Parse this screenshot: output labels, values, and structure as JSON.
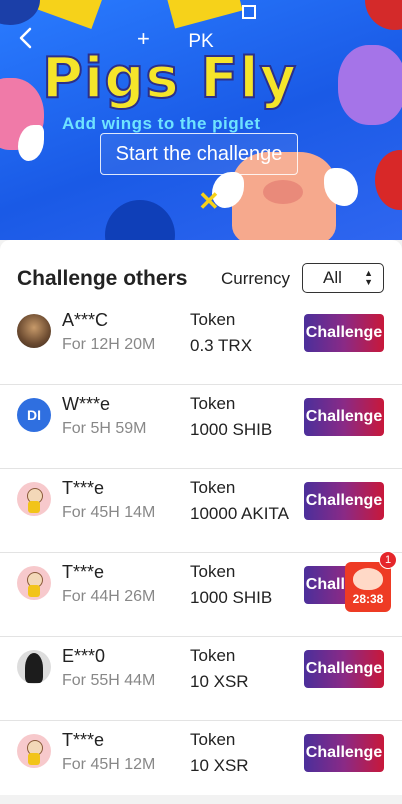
{
  "banner": {
    "page_label": "PK",
    "title": "Pigs Fly",
    "subtitle": "Add wings to the piglet",
    "start_button": "Start the challenge"
  },
  "section": {
    "title": "Challenge others",
    "currency_label": "Currency",
    "currency_value": "All"
  },
  "rows": [
    {
      "user": "A***C",
      "time": "For 12H 20M",
      "token_label": "Token",
      "amount": "0.3 TRX",
      "button": "Challenge",
      "avatar": "photo"
    },
    {
      "user": "W***e",
      "time": "For 5H 59M",
      "token_label": "Token",
      "amount": "1000 SHIB",
      "button": "Challenge",
      "avatar": "logo"
    },
    {
      "user": "T***e",
      "time": "For 45H 14M",
      "token_label": "Token",
      "amount": "10000 AKITA",
      "button": "Challenge",
      "avatar": "cartoon"
    },
    {
      "user": "T***e",
      "time": "For 44H 26M",
      "token_label": "Token",
      "amount": "1000 SHIB",
      "button": "Challenge",
      "avatar": "cartoon"
    },
    {
      "user": "E***0",
      "time": "For 55H 44M",
      "token_label": "Token",
      "amount": "10 XSR",
      "button": "Challenge",
      "avatar": "dark"
    },
    {
      "user": "T***e",
      "time": "For 45H 12M",
      "token_label": "Token",
      "amount": "10 XSR",
      "button": "Challenge",
      "avatar": "cartoon"
    }
  ],
  "red_packet": {
    "badge": "1",
    "timer": "28:38"
  },
  "colors": {
    "accent_gradient_start": "#4b2f9b",
    "accent_gradient_end": "#c8183a",
    "banner_blue": "#2a7cff",
    "title_yellow": "#f5e52a"
  }
}
